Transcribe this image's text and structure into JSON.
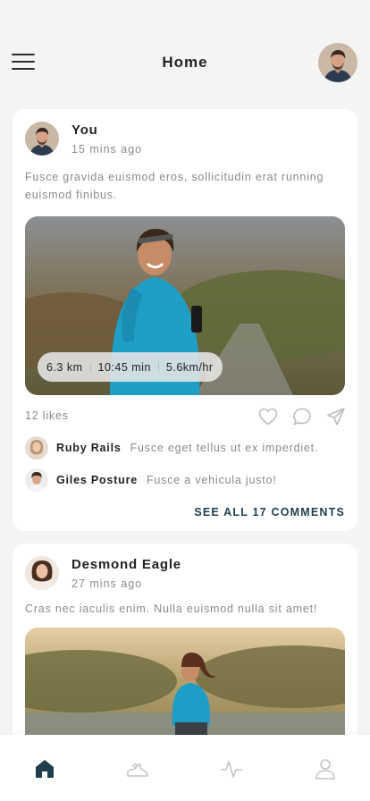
{
  "header": {
    "title": "Home",
    "menu_icon": "menu-icon",
    "profile_avatar": "user-avatar"
  },
  "posts": [
    {
      "author": "You",
      "time": "15 mins ago",
      "text": "Fusce gravida euismod eros, sollicitudin erat running euismod finibus.",
      "stats": {
        "distance": "6.3 km",
        "duration": "10:45 min",
        "speed": "5.6km/hr"
      },
      "likes": "12 likes",
      "comments": [
        {
          "name": "Ruby Rails",
          "text": "Fusce eget tellus ut ex imperdiet."
        },
        {
          "name": "Giles Posture",
          "text": "Fusce a vehicula justo!"
        }
      ],
      "see_all": "SEE ALL 17 COMMENTS"
    },
    {
      "author": "Desmond Eagle",
      "time": "27 mins ago",
      "text": "Cras nec iaculis enim. Nulla euismod nulla sit amet!"
    }
  ],
  "actions": [
    "heart-icon",
    "comment-icon",
    "send-icon"
  ],
  "nav": {
    "items": [
      "home-icon",
      "running-shoe-icon",
      "activity-icon",
      "profile-icon"
    ],
    "active_color": "#1e3e4f",
    "inactive_color": "#c4c4c4"
  }
}
